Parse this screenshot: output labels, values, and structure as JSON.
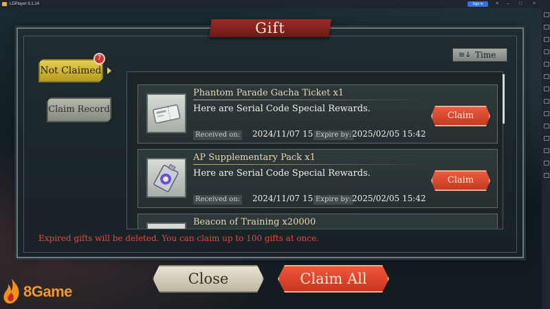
{
  "window": {
    "app_title": "LDPlayer 9.1.24",
    "status_pill": "Sign in"
  },
  "dialog": {
    "title": "Gift",
    "expired_note": "Expired gifts will be deleted. You can claim up to 100 gifts at once."
  },
  "tabs": {
    "not_claimed": "Not Claimed",
    "not_claimed_badge": "7",
    "claim_record": "Claim Record"
  },
  "sort": {
    "icon": "sort-descending-icon",
    "label": "Time"
  },
  "gifts": [
    {
      "title": "Phantom Parade Gacha Ticket x1",
      "description": "Here are Serial Code Special Rewards.",
      "received_label": "Received on:",
      "received": "2024/11/07 15:42",
      "expire_label": "Expire by:",
      "expire": "2025/02/05 15:42",
      "claim_label": "Claim",
      "icon": "ticket-icon"
    },
    {
      "title": "AP Supplementary Pack x1",
      "description": "Here are Serial Code Special Rewards.",
      "received_label": "Received on:",
      "received": "2024/11/07 15:42",
      "expire_label": "Expire by:",
      "expire": "2025/02/05 15:42",
      "claim_label": "Claim",
      "icon": "ap-pack-icon"
    },
    {
      "title": "Beacon of Training x20000",
      "icon": "beacon-icon"
    }
  ],
  "buttons": {
    "close": "Close",
    "claim_all": "Claim All"
  },
  "watermark": {
    "text": "8Game"
  },
  "colors": {
    "accent_red": "#e24a3c",
    "tab_gold": "#e6cf4e",
    "claim_button": "#ef5a3e"
  }
}
